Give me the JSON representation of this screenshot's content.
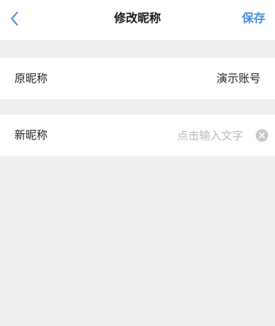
{
  "nav": {
    "title": "修改昵称",
    "save_label": "保存",
    "back_icon": "chevron-left-icon"
  },
  "original": {
    "label": "原昵称",
    "value": "演示账号"
  },
  "new_name": {
    "label": "新昵称",
    "value": "",
    "placeholder": "点击输入文字",
    "clear_icon": "clear-icon"
  },
  "colors": {
    "accent": "#4a90d9",
    "background": "#efeef0",
    "placeholder": "#b9b9b9"
  }
}
